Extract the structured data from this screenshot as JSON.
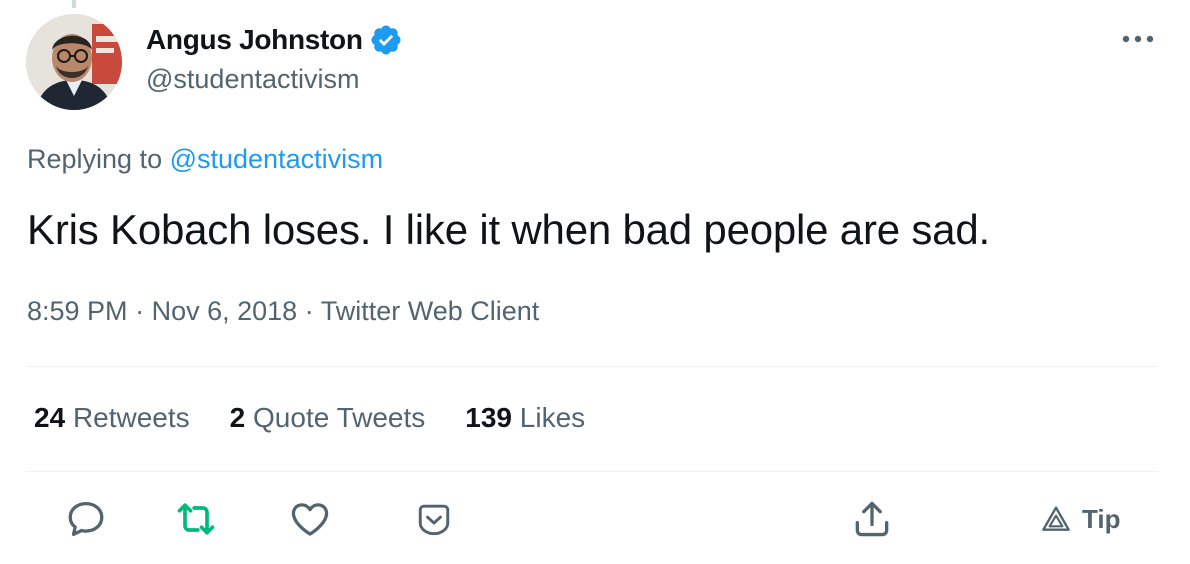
{
  "author": {
    "display_name": "Angus Johnston",
    "handle": "@studentactivism",
    "verified": true
  },
  "reply": {
    "prefix": "Replying to ",
    "to_handle": "@studentactivism"
  },
  "tweet": {
    "text": "Kris Kobach loses. I like it when bad people are sad.",
    "time": "8:59 PM",
    "date": "Nov 6, 2018",
    "client": "Twitter Web Client",
    "separator": "·"
  },
  "stats": {
    "retweets": {
      "count": "24",
      "label": "Retweets"
    },
    "quotes": {
      "count": "2",
      "label": "Quote Tweets"
    },
    "likes": {
      "count": "139",
      "label": "Likes"
    }
  },
  "actions": {
    "tip_label": "Tip"
  },
  "icons": {
    "verified": "verified-badge-icon",
    "more": "more-icon",
    "reply": "reply-icon",
    "retweet": "retweet-icon",
    "like": "heart-icon",
    "bookmark": "bookmark-icon",
    "share": "share-icon",
    "tip": "tip-icon"
  },
  "colors": {
    "text_primary": "#0f1419",
    "text_secondary": "#536471",
    "link": "#1d9bf0",
    "verified": "#1d9bf0",
    "retweet_active": "#00ba7c",
    "divider": "#eff3f4"
  }
}
